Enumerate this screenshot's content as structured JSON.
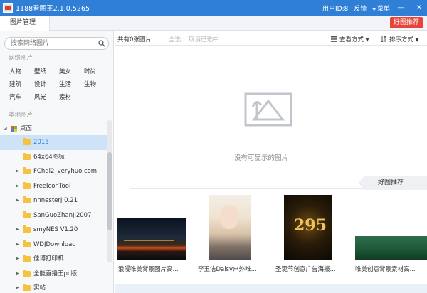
{
  "window": {
    "title": "1188看图王2.1.0.5265",
    "user_id": "用户ID:8",
    "feedback": "反馈",
    "menu": "菜单",
    "minimize": "—",
    "close": "✕"
  },
  "tabbar": {
    "tab_label": "图片管理",
    "good_rec_button": "好图推荐"
  },
  "sidebar": {
    "search_placeholder": "搜索网络图片",
    "network_label": "网络图片",
    "network_tags": [
      "人物",
      "壁纸",
      "美女",
      "时尚",
      "建筑",
      "设计",
      "生活",
      "生物",
      "汽车",
      "风光",
      "素材"
    ],
    "local_label": "本地图片",
    "root": "桌面",
    "folders": [
      {
        "label": "2015",
        "has_arrow": false,
        "selected": true
      },
      {
        "label": "64x64图标",
        "has_arrow": false,
        "selected": false
      },
      {
        "label": "FChdl2_veryhuo.com",
        "has_arrow": true,
        "selected": false
      },
      {
        "label": "FreeIconTool",
        "has_arrow": true,
        "selected": false
      },
      {
        "label": "nnnesterJ 0.21",
        "has_arrow": true,
        "selected": false
      },
      {
        "label": "SanGuoZhanJi2007",
        "has_arrow": false,
        "selected": false
      },
      {
        "label": "smyNES V1.20",
        "has_arrow": true,
        "selected": false
      },
      {
        "label": "WDJDownload",
        "has_arrow": true,
        "selected": false
      },
      {
        "label": "佳博打印机",
        "has_arrow": true,
        "selected": false
      },
      {
        "label": "全能直播王pc版",
        "has_arrow": true,
        "selected": false
      },
      {
        "label": "实帖",
        "has_arrow": true,
        "selected": false
      }
    ]
  },
  "main": {
    "count": "共有0张图片",
    "select_all": "全选",
    "deselect": "取消已选中",
    "view_mode": "查看方式",
    "sort_mode": "排序方式",
    "empty_text": "没有可显示的图片",
    "rec_tab": "好图推荐",
    "thumbnails": [
      {
        "caption": "浪漫唯美背景图片高..."
      },
      {
        "caption": "李玉洁Daisy户外唯..."
      },
      {
        "caption": "圣诞节创意广告海报..."
      },
      {
        "caption": "唯美创意背景素材高..."
      }
    ],
    "thumb3_number": "295"
  },
  "colors": {
    "titlebar": "#2f7fd7",
    "accent_red": "#e8443a",
    "selected_row": "#cfe3f8",
    "folder": "#f5c242"
  }
}
